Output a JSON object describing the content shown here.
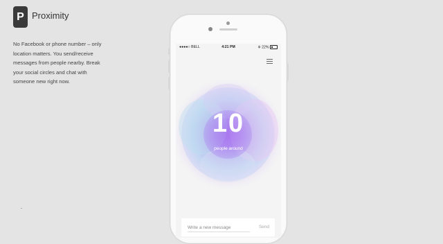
{
  "brand": {
    "logo_letter": "P",
    "name": "Proximity"
  },
  "description": "No Facebook or phone number – only location matters. You send/receive messages from people nearby. Break your social circles and chat with someone new right now.",
  "status_bar": {
    "carrier": "●●●●○ BELL",
    "time": "4:21 PM",
    "battery": "22%"
  },
  "counter": {
    "value": "10",
    "label": "people around"
  },
  "composer": {
    "placeholder": "Write a new message",
    "send_label": "Send"
  },
  "colors": {
    "background": "#e4e4e4",
    "bubble_core": "#a879f0",
    "bubble_mid": "#c3d6f2"
  }
}
